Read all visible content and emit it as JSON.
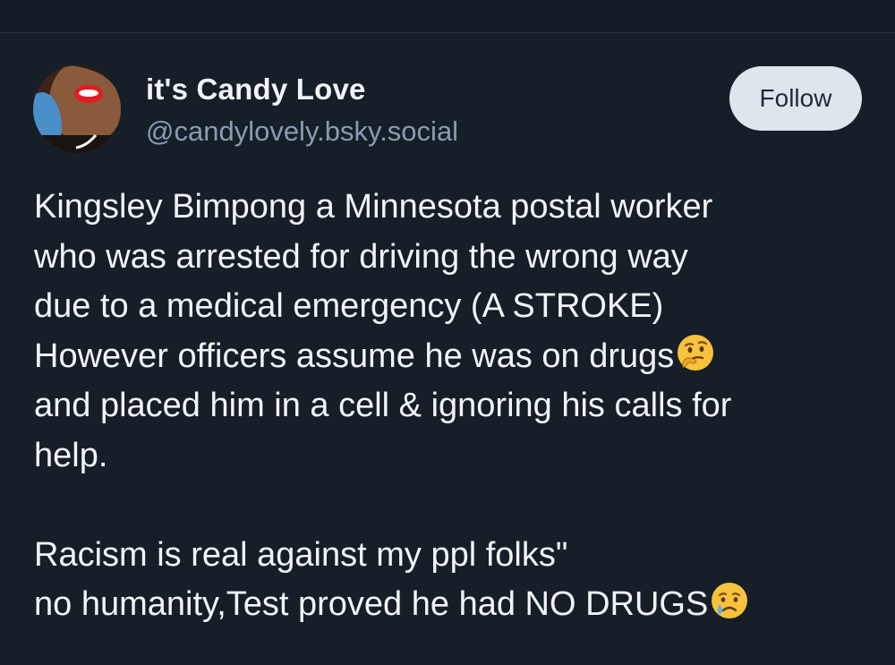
{
  "author": {
    "display_name": "it's Candy Love",
    "handle": "@candylovely.bsky.social",
    "avatar_icon": "avatar-photo"
  },
  "follow_button": {
    "label": "Follow"
  },
  "post": {
    "lines": [
      "Kingsley Bimpong a Minnesota postal worker",
      "who was arrested for driving the wrong way",
      "due to a medical emergency (A STROKE)",
      "However officers assume he was on drugs",
      "and placed him in a cell & ignoring his calls for",
      "help."
    ],
    "lines_2": [
      "Racism is real against my ppl folks\"",
      "no humanity,Test proved he had NO DRUGS"
    ],
    "emoji_1": "thinking-face-icon",
    "emoji_2": "crying-face-icon"
  },
  "colors": {
    "background": "#161e28",
    "text": "#f2f4f6",
    "handle": "#8b9bb0",
    "follow_bg": "#dfe5ec"
  }
}
